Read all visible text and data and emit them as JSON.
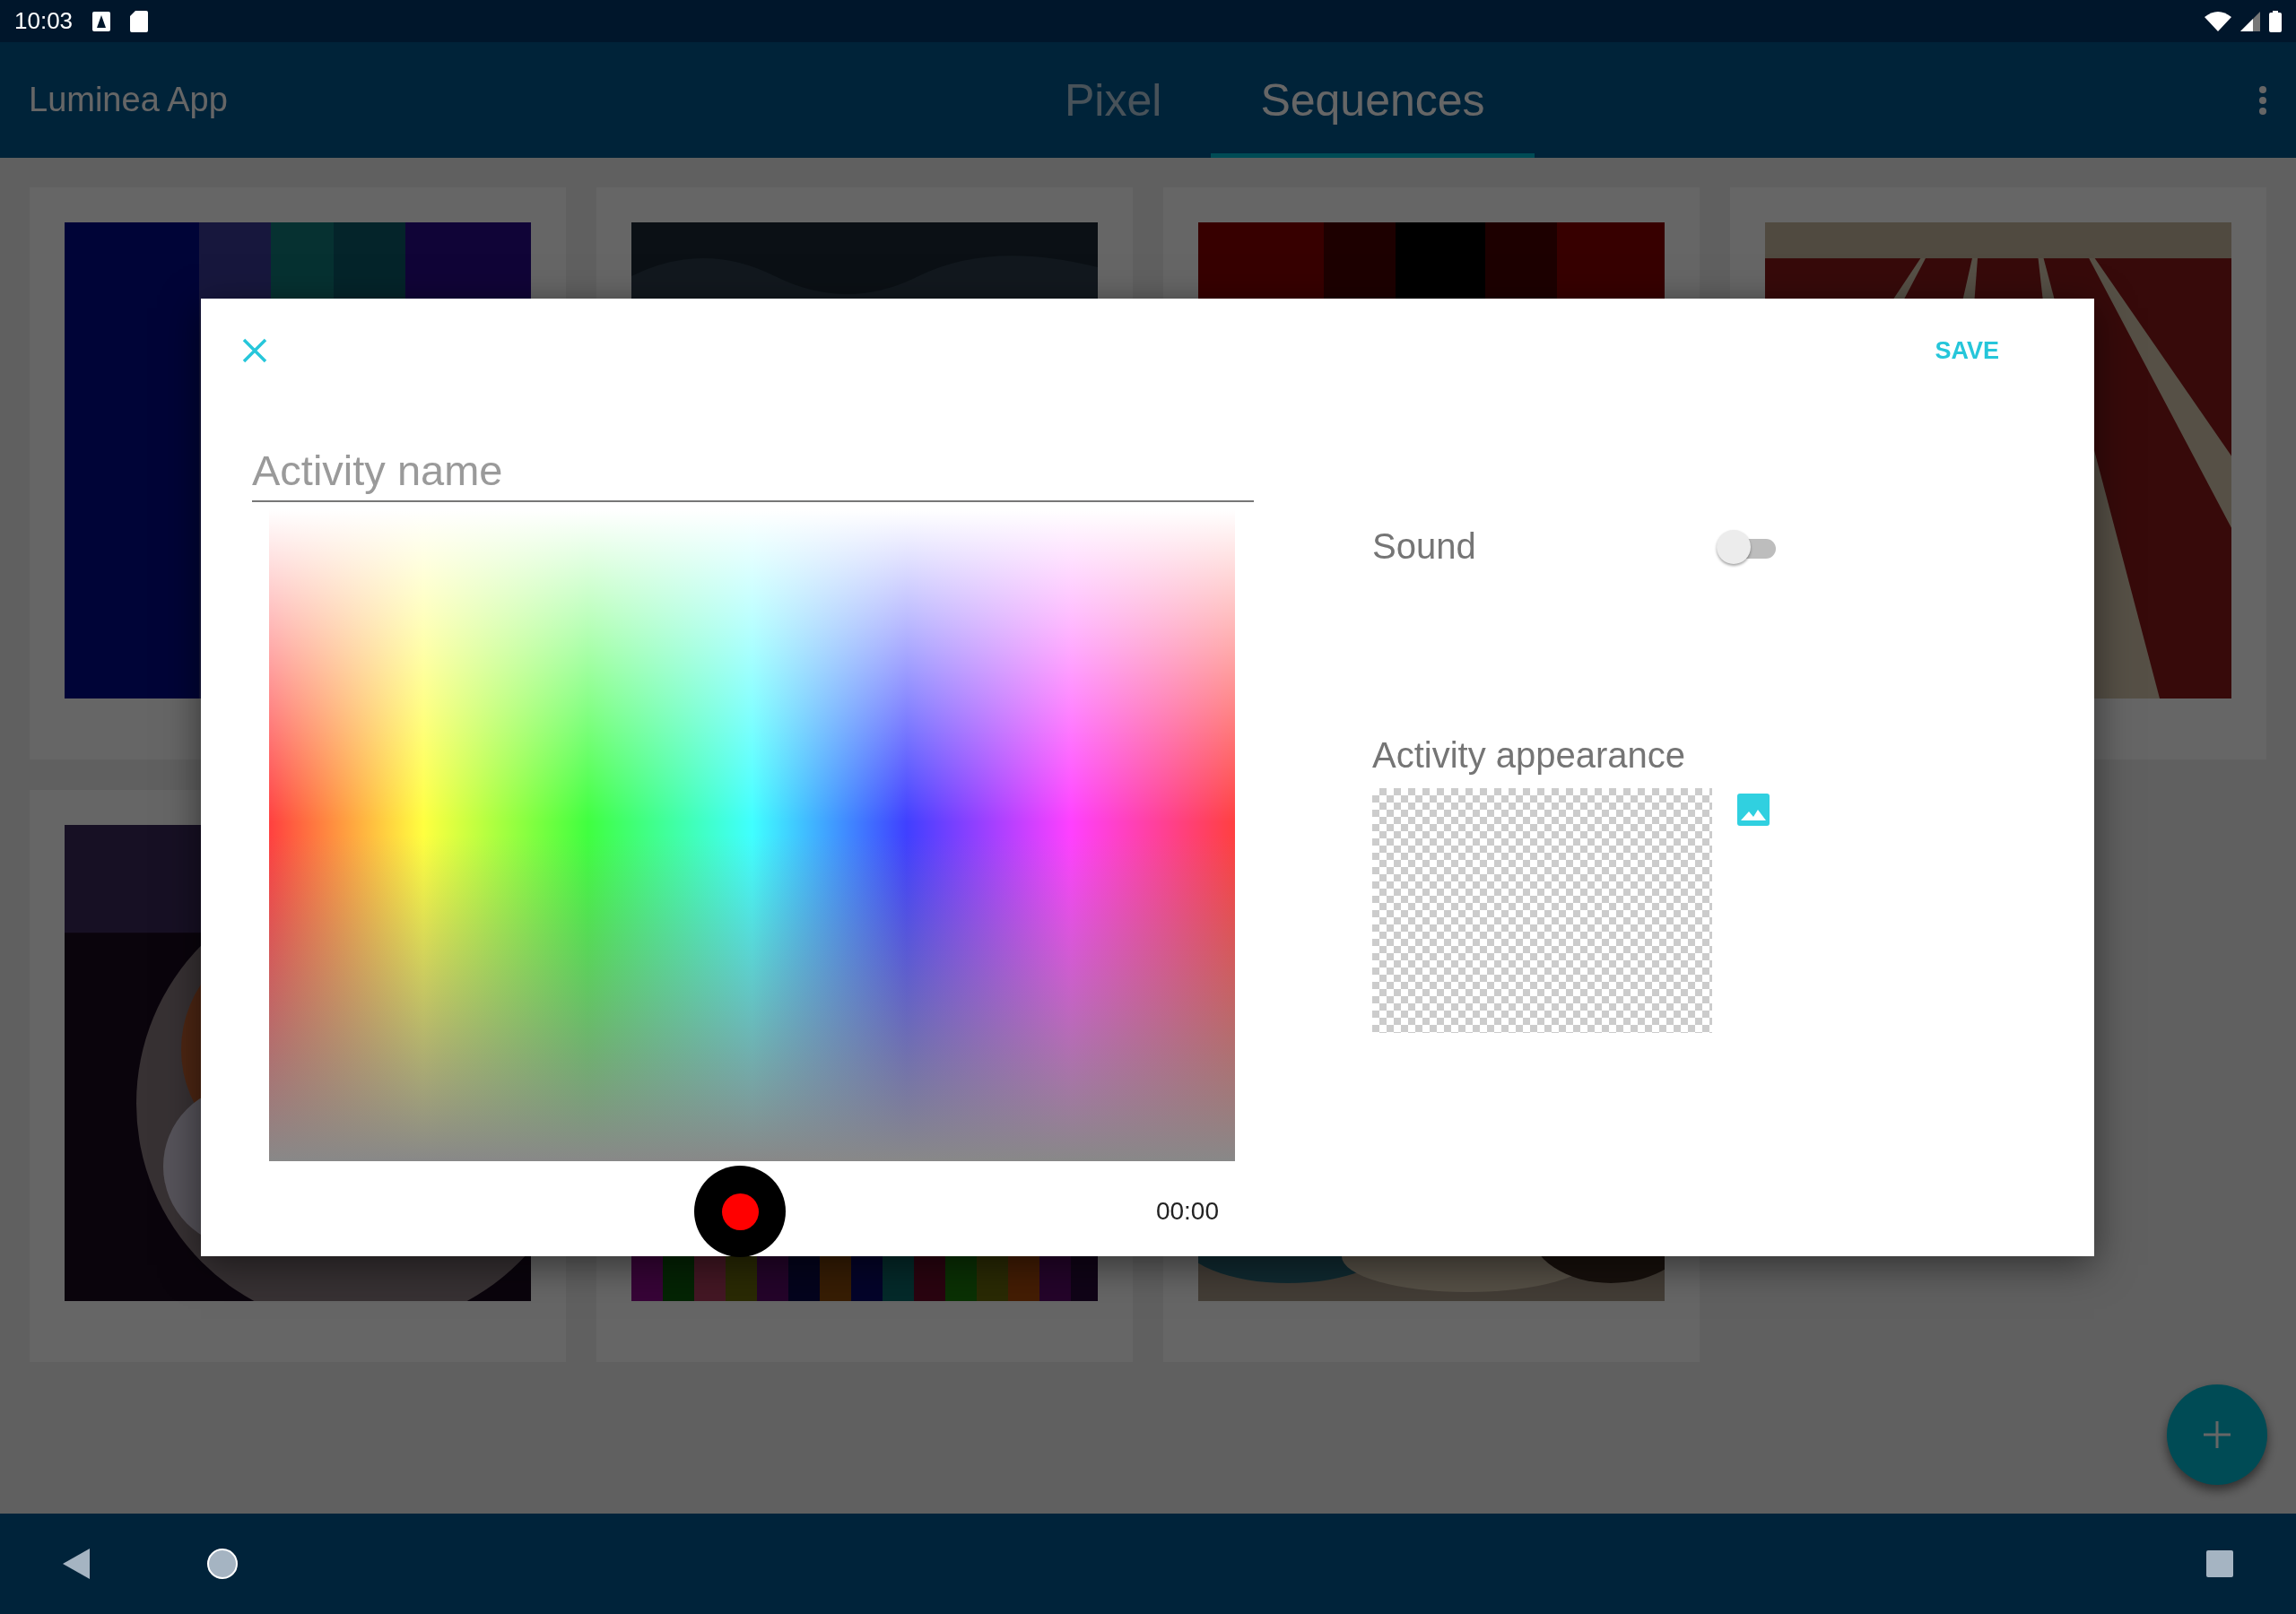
{
  "status_bar": {
    "time": "10:03"
  },
  "app_bar": {
    "title": "Luminea App",
    "tabs": [
      {
        "label": "Pixel",
        "selected": false
      },
      {
        "label": "Sequences",
        "selected": true
      }
    ]
  },
  "dialog": {
    "save": "SAVE",
    "name_field": {
      "placeholder": "Activity name"
    },
    "timer": "00:00",
    "sound": {
      "label": "Sound",
      "on": false
    },
    "appearance": {
      "label": "Activity appearance"
    }
  }
}
